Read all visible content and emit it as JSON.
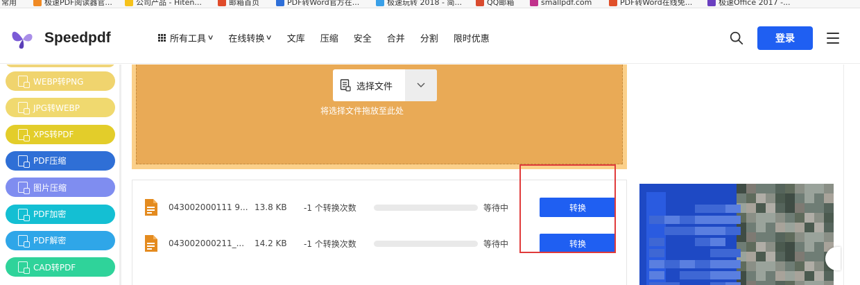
{
  "bookmarks": [
    {
      "label": "常用",
      "color": "#d0d0d0"
    },
    {
      "label": "极速PDF阅读器官...",
      "color": "#f08a24"
    },
    {
      "label": "公司产品 - Hiten...",
      "color": "#f6c21b"
    },
    {
      "label": "邮箱首页",
      "color": "#e04b2a"
    },
    {
      "label": "PDF转Word官方在...",
      "color": "#2f6fd8"
    },
    {
      "label": "极速玩转 2018 - 简...",
      "color": "#3aa0e8"
    },
    {
      "label": "QQ邮箱",
      "color": "#d94b2f"
    },
    {
      "label": "smallpdf.com",
      "color": "#c0328c"
    },
    {
      "label": "PDF转Word在线免...",
      "color": "#e0502a"
    },
    {
      "label": "极速Office 2017 -...",
      "color": "#6a3fc0"
    }
  ],
  "header": {
    "logo_text": "Speedpdf",
    "nav": [
      {
        "label": "所有工具",
        "has_grid": true,
        "has_chevron": true
      },
      {
        "label": "在线转换",
        "has_grid": false,
        "has_chevron": true
      },
      {
        "label": "文库",
        "has_grid": false,
        "has_chevron": false
      },
      {
        "label": "压缩",
        "has_grid": false,
        "has_chevron": false
      },
      {
        "label": "安全",
        "has_grid": false,
        "has_chevron": false
      },
      {
        "label": "合并",
        "has_grid": false,
        "has_chevron": false
      },
      {
        "label": "分割",
        "has_grid": false,
        "has_chevron": false
      },
      {
        "label": "限时优惠",
        "has_grid": false,
        "has_chevron": false
      }
    ],
    "login_label": "登录"
  },
  "sidebar": {
    "items": [
      {
        "label": "WEBP转PNG",
        "color": "#f0d46e"
      },
      {
        "label": "JPG转WEBP",
        "color": "#f0d96f"
      },
      {
        "label": "XPS转PDF",
        "color": "#e3cd2a"
      },
      {
        "label": "PDF压缩",
        "color": "#2f6fd6"
      },
      {
        "label": "图片压缩",
        "color": "#7f8df0"
      },
      {
        "label": "PDF加密",
        "color": "#14bfd3"
      },
      {
        "label": "PDF解密",
        "color": "#2fa6e8"
      },
      {
        "label": "CAD转PDF",
        "color": "#2fd39a"
      }
    ]
  },
  "upload": {
    "choose_label": "选择文件",
    "drop_hint": "将选择文件拖放至此处"
  },
  "files": [
    {
      "name": "043002000111 9...",
      "size": "13.8 KB",
      "count": "-1 个转换次数",
      "progress": 0,
      "status": "等待中",
      "action": "转换"
    },
    {
      "name": "043002000211_...",
      "size": "14.2 KB",
      "count": "-1 个转换次数",
      "progress": 0,
      "status": "等待中",
      "action": "转换"
    }
  ],
  "colors": {
    "accent": "#1f5ff2",
    "upload_bg": "#e9aa56",
    "highlight": "#e03a3a"
  }
}
